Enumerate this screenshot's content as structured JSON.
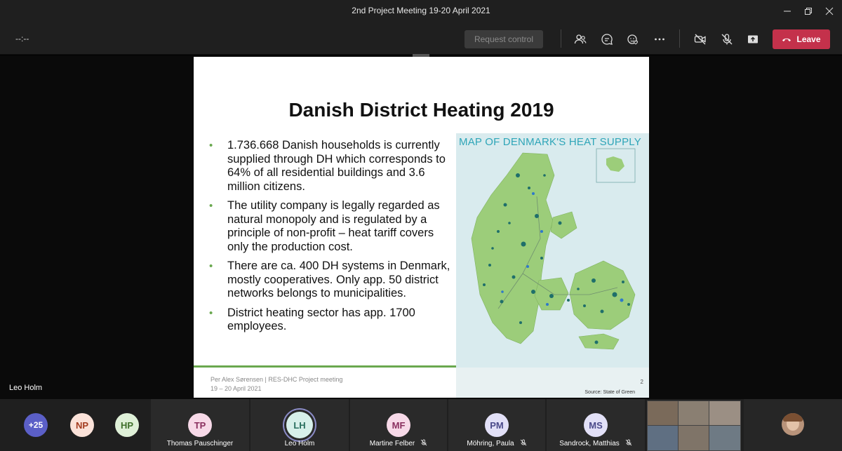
{
  "window": {
    "title": "2nd Project Meeting 19-20 April 2021"
  },
  "toolbar": {
    "timer": "--:--",
    "request_control": "Request control",
    "leave_label": "Leave",
    "icons": [
      "people-icon",
      "chat-icon",
      "reactions-icon",
      "more-icon",
      "camera-off-icon",
      "mic-off-icon",
      "share-icon"
    ]
  },
  "stage": {
    "presenter_name": "Leo Holm"
  },
  "slide": {
    "title": "Danish District Heating 2019",
    "bullets": [
      "1.736.668 Danish households is currently supplied through DH which corresponds to 64% of all residential buildings and 3.6 million citizens.",
      "The utility company is legally regarded as natural monopoly and is regulated by a principle of non-profit – heat tariff covers only the production cost.",
      "There are ca. 400 DH systems in Denmark, mostly cooperatives. Only app. 50 district networks belongs to municipalities.",
      "District heating sector has app. 1700 employees."
    ],
    "footer_line1": "Per Alex Sørensen | RES-DHC Project meeting",
    "footer_line2": "19 – 20 April 2021",
    "map_title": "MAP OF DENMARK'S HEAT SUPPLY",
    "map_source": "Source: State of Green",
    "page_number": "2",
    "accent_color": "#6aa84f"
  },
  "participants": {
    "overflow": {
      "initials": "+25",
      "color": "#5b5fc7"
    },
    "small": [
      {
        "initials": "NP",
        "bg": "#fbe2d9",
        "fg": "#a33b1f"
      },
      {
        "initials": "HP",
        "bg": "#dff0d8",
        "fg": "#3f6f2a"
      }
    ],
    "tiles": [
      {
        "initials": "TP",
        "name": "Thomas Pauschinger",
        "bg": "#f7d9e8",
        "fg": "#8a2f5f",
        "muted": false
      },
      {
        "initials": "LH",
        "name": "Leo Holm",
        "bg": "#d7f0ea",
        "fg": "#2a6f5f",
        "muted": false,
        "speaking": true
      },
      {
        "initials": "MF",
        "name": "Martine Felber",
        "bg": "#f7d9e8",
        "fg": "#8a2f5f",
        "muted": true
      },
      {
        "initials": "PM",
        "name": "Möhring, Paula",
        "bg": "#e2e0f7",
        "fg": "#4b4a8a",
        "muted": true
      },
      {
        "initials": "MS",
        "name": "Sandrock, Matthias",
        "bg": "#e2e0f7",
        "fg": "#4b4a8a",
        "muted": true
      }
    ]
  }
}
